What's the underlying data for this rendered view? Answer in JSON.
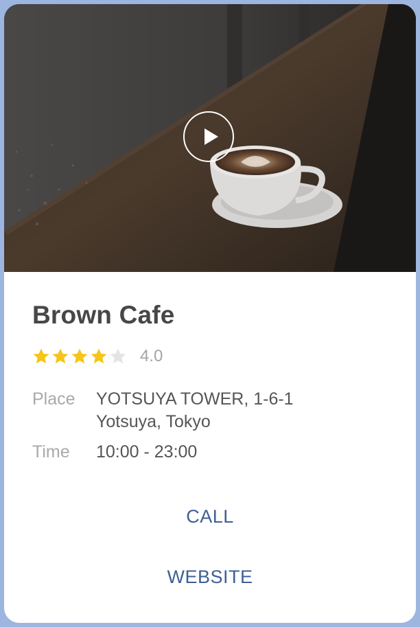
{
  "card": {
    "title": "Brown Cafe",
    "rating": {
      "value_text": "4.0",
      "stars_filled": 4,
      "stars_total": 5,
      "star_color": "#f5c518",
      "star_empty_color": "#e4e4e4"
    },
    "place": {
      "label": "Place",
      "value": "YOTSUYA TOWER, 1-6-1\nYotsuya, Tokyo"
    },
    "time": {
      "label": "Time",
      "value": "10:00 - 23:00"
    },
    "actions": {
      "call_label": "CALL",
      "website_label": "WEBSITE"
    },
    "hero": {
      "play_icon": "play-icon"
    }
  },
  "colors": {
    "background": "#9db6e0",
    "action": "#3d5f95",
    "title": "#474747"
  }
}
